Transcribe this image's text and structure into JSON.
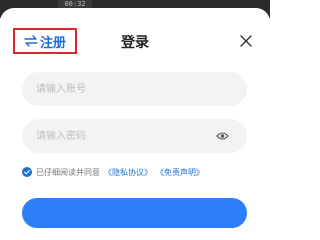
{
  "video": {
    "time": "00:32"
  },
  "header": {
    "register_label": "注册",
    "title": "登录"
  },
  "form": {
    "account_placeholder": "请输入账号",
    "password_placeholder": "请输入密码"
  },
  "agreement": {
    "text": "已仔细阅读并同意",
    "privacy_link": "《隐私协议》",
    "disclaimer_link": "《免责声明》"
  },
  "colors": {
    "accent": "#1f6fd1",
    "highlight_border": "#e0242b",
    "input_bg": "#f3f3f5",
    "primary_button": "#2d7ff9"
  }
}
